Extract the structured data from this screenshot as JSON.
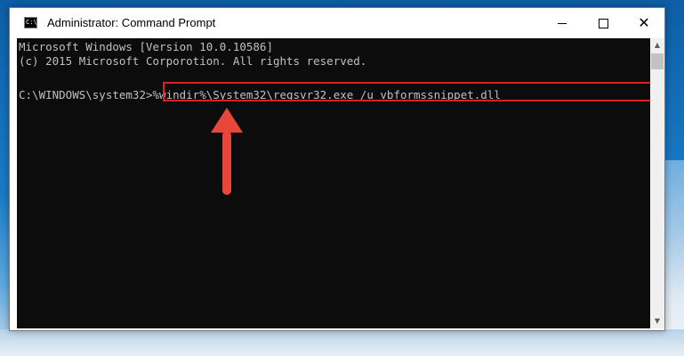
{
  "window": {
    "title": "Administrator: Command Prompt",
    "icon": "cmd-icon",
    "icon_glyph": "C:\\",
    "minimize_icon": "minimize-icon",
    "maximize_icon": "maximize-icon",
    "close_icon": "close-icon",
    "close_glyph": "✕"
  },
  "console": {
    "lines": [
      "Microsoft Windows [Version 10.0.10586]",
      "(c) 2015 Microsoft Corporotion. All rights reserved."
    ],
    "prompt": "C:\\WINDOWS\\system32>",
    "command": "%windir%\\System32\\regsvr32.exe /u vbformssnippet.dll"
  },
  "scrollbar": {
    "up_glyph": "▲",
    "down_glyph": "▼"
  },
  "annotation": {
    "highlight_color": "#e02020",
    "arrow_color": "#e8463a",
    "arrow_icon": "up-arrow-icon"
  },
  "colors": {
    "console_bg": "#0c0c0c",
    "console_text": "#c0c0c0"
  }
}
